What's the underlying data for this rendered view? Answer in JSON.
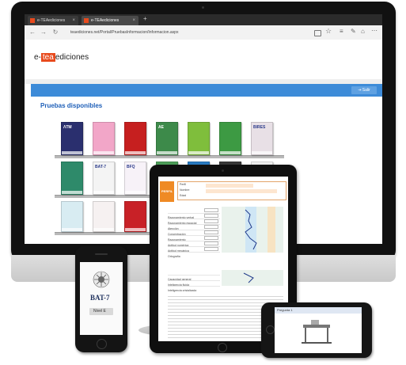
{
  "browser": {
    "tabs": [
      {
        "label": "e-TEAediciones",
        "active": false
      },
      {
        "label": "e-TEAediciones",
        "active": true
      }
    ],
    "new_tab": "+",
    "url": "teaediciones.net/Portal/PruebasInformacion/Informacion.aspx",
    "nav": {
      "back": "←",
      "forward": "→",
      "refresh": "↻"
    },
    "icons": [
      "reading-view-icon",
      "star-icon",
      "hub-icon",
      "notes-icon",
      "share-icon",
      "more-icon"
    ]
  },
  "site": {
    "logo_prefix": "e-",
    "logo_mid": "tea",
    "logo_suffix": "ediciones",
    "exit_label": "Salir",
    "heading": "Pruebas disponibles"
  },
  "books": {
    "row1": [
      {
        "color": "#2a2f6e",
        "tag": "ΛTM"
      },
      {
        "color": "#f2a6c8",
        "tag": ""
      },
      {
        "color": "#c61f1f",
        "tag": ""
      },
      {
        "color": "#3d8a4a",
        "tag": "AE"
      },
      {
        "color": "#7fbe3c",
        "tag": ""
      },
      {
        "color": "#3d9a43",
        "tag": ""
      },
      {
        "color": "#e8e0e6",
        "tag": "BIRES"
      }
    ],
    "row2": [
      {
        "color": "#2e8a6a",
        "tag": ""
      },
      {
        "color": "#f4f4f4",
        "tag": "BAT-7"
      },
      {
        "color": "#f7f2f8",
        "tag": "BFQ"
      },
      {
        "color": "#4ea05a",
        "tag": ""
      },
      {
        "color": "#2a7cc4",
        "tag": "BIOS"
      },
      {
        "color": "#3a3a3a",
        "tag": ""
      },
      {
        "color": "#f2f2f2",
        "tag": ""
      }
    ],
    "row3": [
      {
        "color": "#d8ecf2",
        "tag": ""
      },
      {
        "color": "#f6f1f1",
        "tag": ""
      },
      {
        "color": "#c82127",
        "tag": ""
      },
      {
        "color": "#e8e0d6",
        "tag": ""
      }
    ]
  },
  "ipad": {
    "banner_text": "PERFIL",
    "header_lines": [
      "Perfil",
      "Nombre",
      "Edad"
    ],
    "report_rows": [
      "Razonamiento verbal",
      "Razonamiento espacial",
      "Atención",
      "Concentración",
      "Razonamiento",
      "Aptitud numérica",
      "Aptitud mecánica",
      "Ortografía"
    ],
    "bottom_rows": [
      "Capacidad general",
      "Inteligencia fluida",
      "Inteligencia cristalizada"
    ]
  },
  "iphone": {
    "logo_text": "BAT-7",
    "level_label": "Nivel E"
  },
  "iphone_landscape": {
    "question_label": "Pregunta 1"
  }
}
